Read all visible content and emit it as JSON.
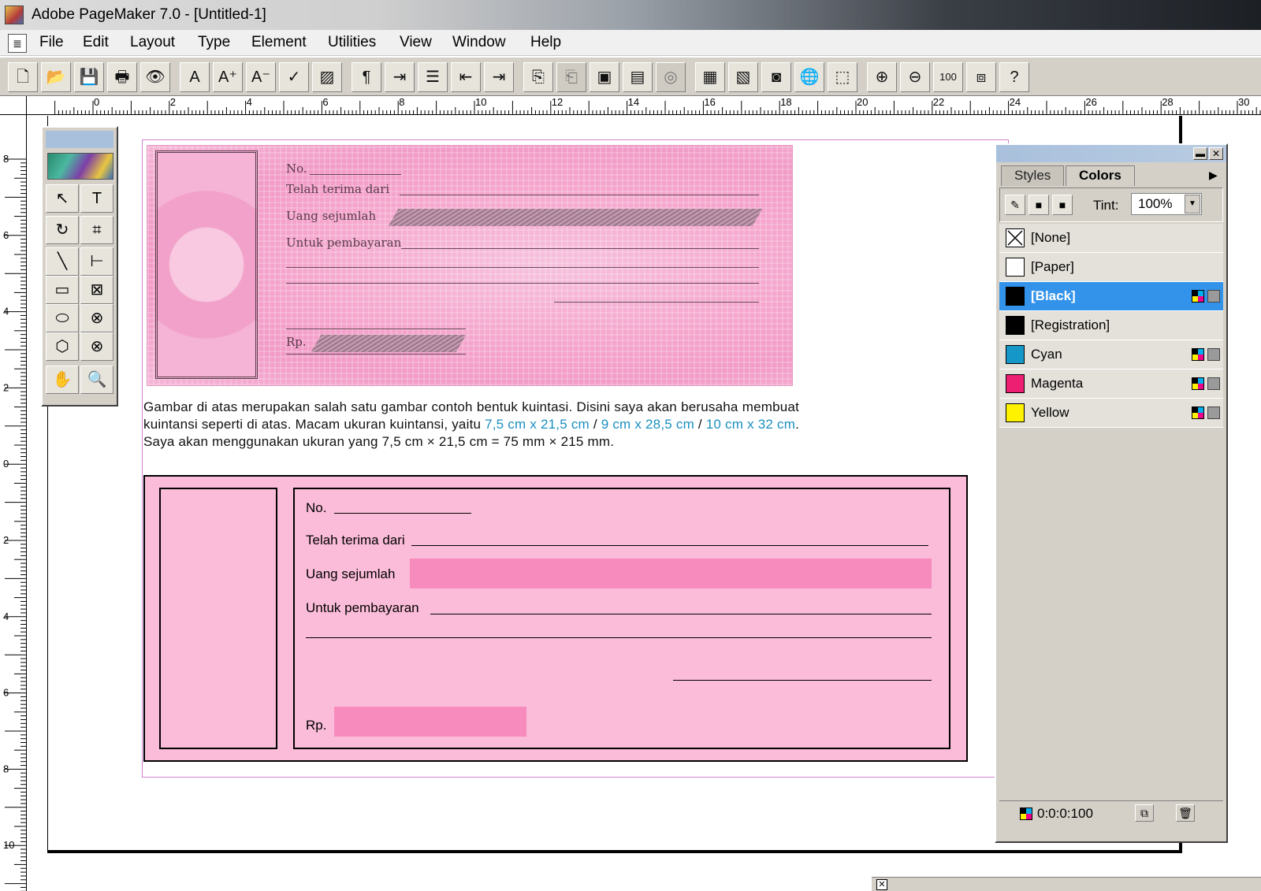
{
  "window": {
    "title": "Adobe PageMaker 7.0 - [Untitled-1]"
  },
  "menu": {
    "system_icon": "≣",
    "items": [
      "File",
      "Edit",
      "Layout",
      "Type",
      "Element",
      "Utilities",
      "View",
      "Window",
      "Help"
    ]
  },
  "toolbar": {
    "buttons": [
      {
        "icon": "new-document-icon",
        "glyph": "🗋"
      },
      {
        "icon": "open-folder-icon",
        "glyph": "📂"
      },
      {
        "icon": "save-icon",
        "glyph": "💾"
      },
      {
        "icon": "print-icon",
        "glyph": "🖶"
      },
      {
        "icon": "find-binoculars-icon",
        "glyph": "👁"
      },
      {
        "icon": "font-icon",
        "glyph": "A"
      },
      {
        "icon": "font-size-up-icon",
        "glyph": "A⁺"
      },
      {
        "icon": "font-size-down-icon",
        "glyph": "A⁻"
      },
      {
        "icon": "spell-check-icon",
        "glyph": "✓"
      },
      {
        "icon": "fill-stroke-icon",
        "glyph": "▨"
      },
      {
        "icon": "paragraph-icon",
        "glyph": "¶"
      },
      {
        "icon": "indent-tabs-icon",
        "glyph": "⇥"
      },
      {
        "icon": "bullets-icon",
        "glyph": "☰"
      },
      {
        "icon": "decrease-indent-icon",
        "glyph": "⇤"
      },
      {
        "icon": "increase-indent-icon",
        "glyph": "⇥"
      },
      {
        "icon": "new-page-icon",
        "glyph": "⎘"
      },
      {
        "icon": "master-page-icon",
        "glyph": "⎗",
        "pressed": true
      },
      {
        "icon": "frame-icon",
        "glyph": "▣"
      },
      {
        "icon": "image-control-icon",
        "glyph": "▤"
      },
      {
        "icon": "link-icon",
        "glyph": "◎",
        "pressed": true
      },
      {
        "icon": "place-image-icon",
        "glyph": "▦"
      },
      {
        "icon": "picture-palette-icon",
        "glyph": "▧"
      },
      {
        "icon": "acrobat-icon",
        "glyph": "◙"
      },
      {
        "icon": "globe-icon",
        "glyph": "🌐"
      },
      {
        "icon": "pdf-icon",
        "glyph": "⬚"
      },
      {
        "icon": "zoom-in-icon",
        "glyph": "⊕"
      },
      {
        "icon": "zoom-out-icon",
        "glyph": "⊖"
      },
      {
        "icon": "actual-size-icon",
        "glyph": "100"
      },
      {
        "icon": "fit-window-icon",
        "glyph": "⧈"
      },
      {
        "icon": "help-icon",
        "glyph": "?"
      }
    ]
  },
  "ruler": {
    "h_labels": [
      "0",
      "2",
      "4",
      "6",
      "8",
      "10",
      "12",
      "14",
      "16",
      "18",
      "20",
      "22",
      "24",
      "26",
      "28",
      "30"
    ],
    "v_labels": [
      "8",
      "6",
      "4",
      "2",
      "0",
      "2",
      "4",
      "6",
      "8",
      "10"
    ]
  },
  "sample": {
    "no": "No.",
    "telah": "Telah terima dari",
    "uang": "Uang sejumlah",
    "untuk": "Untuk pembayaran",
    "rp": "Rp."
  },
  "description": {
    "part1": "Gambar di atas merupakan salah satu gambar contoh bentuk kuintasi. Disini saya akan berusaha membuat kuintansi seperti di atas. Macam ukuran kuintansi, yaitu ",
    "size1": "7,5 cm x 21,5 cm",
    "sep1": " / ",
    "size2": "9 cm x 28,5 cm",
    "sep2": " / ",
    "size3": "10 cm x 32 cm",
    "part2": ". Saya akan menggunakan ukuran yang 7,5 cm × 21,5 cm = 75 mm × 215 mm."
  },
  "receipt": {
    "no": "No.",
    "telah": "Telah terima dari",
    "uang": "Uang  sejumlah",
    "untuk": "Untuk pembayaran",
    "rp": "Rp."
  },
  "toolbox": {
    "tools": [
      {
        "name": "pointer-tool",
        "glyph": "↖"
      },
      {
        "name": "text-tool",
        "glyph": "T"
      },
      {
        "name": "rotate-tool",
        "glyph": "↻"
      },
      {
        "name": "crop-tool",
        "glyph": "⌗"
      },
      {
        "name": "line-tool",
        "glyph": "╲"
      },
      {
        "name": "constrained-line-tool",
        "glyph": "⊢"
      },
      {
        "name": "rectangle-tool",
        "glyph": "▭"
      },
      {
        "name": "rectangle-frame-tool",
        "glyph": "⊠"
      },
      {
        "name": "ellipse-tool",
        "glyph": "⬭"
      },
      {
        "name": "ellipse-frame-tool",
        "glyph": "⊗"
      },
      {
        "name": "polygon-tool",
        "glyph": "⬡"
      },
      {
        "name": "polygon-frame-tool",
        "glyph": "⊗"
      },
      {
        "name": "hand-tool",
        "glyph": "✋"
      },
      {
        "name": "zoom-tool",
        "glyph": "🔍"
      }
    ]
  },
  "palette": {
    "tabs": [
      "Styles",
      "Colors"
    ],
    "active_tab": "Colors",
    "tint_label": "Tint:",
    "tint_value": "100%",
    "colors": [
      {
        "name": "[None]",
        "swatch": "none",
        "process": false
      },
      {
        "name": "[Paper]",
        "swatch": "#ffffff",
        "process": false
      },
      {
        "name": "[Black]",
        "swatch": "#000000",
        "process": true,
        "selected": true
      },
      {
        "name": "[Registration]",
        "swatch": "#000000",
        "process": false
      },
      {
        "name": "Cyan",
        "swatch": "#1597c7",
        "process": true
      },
      {
        "name": "Magenta",
        "swatch": "#ec1f73",
        "process": true
      },
      {
        "name": "Yellow",
        "swatch": "#fff200",
        "process": true
      }
    ],
    "cmyk_value": "0:0:0:100"
  },
  "colors": {
    "receipt_bg": "#fbbcd9",
    "receipt_fill": "#f78bbd",
    "highlight_text": "#1a8fc0",
    "selected_row": "#3393ea"
  }
}
